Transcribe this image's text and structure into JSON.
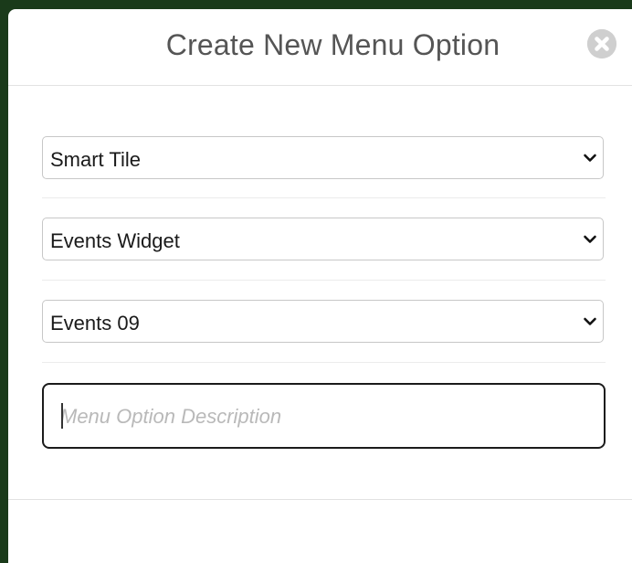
{
  "dialog": {
    "title": "Create New Menu Option",
    "close_icon": "close-circle-icon"
  },
  "fields": {
    "type_select": {
      "value": "Smart Tile",
      "icon": "chevron-down-icon"
    },
    "widget_select": {
      "value": "Events Widget",
      "icon": "chevron-down-icon"
    },
    "item_select": {
      "value": "Events 09",
      "icon": "chevron-down-icon"
    },
    "description": {
      "value": "",
      "placeholder": "Menu Option Description"
    }
  },
  "colors": {
    "backdrop": "#1a3a1a",
    "modal_bg": "#ffffff",
    "title_text": "#555555",
    "close_button": "#cfcfcf",
    "input_border_focus": "#1b1b1b"
  }
}
